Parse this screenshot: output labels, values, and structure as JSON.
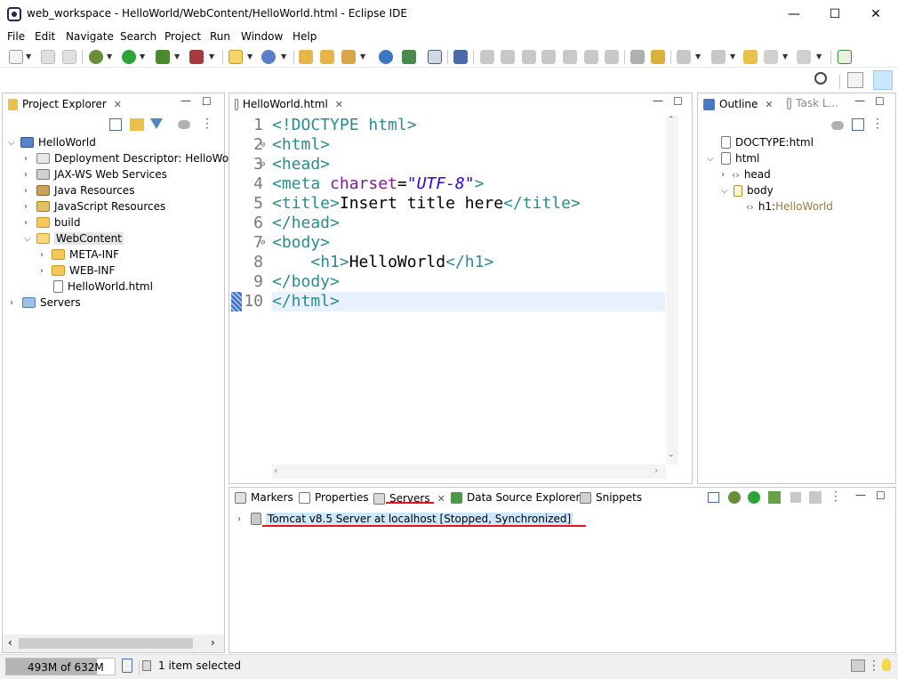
{
  "window": {
    "title": "web_workspace - HelloWorld/WebContent/HelloWorld.html - Eclipse IDE",
    "minimize": "—",
    "maximize": "☐",
    "close": "✕"
  },
  "menu": [
    "File",
    "Edit",
    "Navigate",
    "Search",
    "Project",
    "Run",
    "Window",
    "Help"
  ],
  "project_explorer": {
    "tab": "Project Explorer",
    "tree": [
      {
        "label": "HelloWorld"
      },
      {
        "label": "Deployment Descriptor: HelloWorld"
      },
      {
        "label": "JAX-WS Web Services"
      },
      {
        "label": "Java Resources"
      },
      {
        "label": "JavaScript Resources"
      },
      {
        "label": "build"
      },
      {
        "label": "WebContent"
      },
      {
        "label": "META-INF"
      },
      {
        "label": "WEB-INF"
      },
      {
        "label": "HelloWorld.html"
      },
      {
        "label": "Servers"
      }
    ]
  },
  "editor": {
    "tab": "HelloWorld.html",
    "lines": [
      {
        "n": "1"
      },
      {
        "n": "2"
      },
      {
        "n": "3"
      },
      {
        "n": "4"
      },
      {
        "n": "5"
      },
      {
        "n": "6"
      },
      {
        "n": "7"
      },
      {
        "n": "8"
      },
      {
        "n": "9"
      },
      {
        "n": "10"
      }
    ],
    "code": {
      "l1": "<!DOCTYPE html>",
      "l2": "<html>",
      "l3": "<head>",
      "l4_open": "<meta ",
      "l4_attr": "charset",
      "l4_eq": "=",
      "l4_str": "\"UTF-8\"",
      "l4_close": ">",
      "l5_open": "<title>",
      "l5_text": "Insert title here",
      "l5_close": "</title>",
      "l6": "</head>",
      "l7": "<body>",
      "l8_indent": "    ",
      "l8_open": "<h1>",
      "l8_text": "HelloWorld",
      "l8_close": "</h1>",
      "l9": "</body>",
      "l10": "</html>"
    }
  },
  "outline": {
    "tab": "Outline",
    "tab2": "Task L...",
    "tree": {
      "doctype": "DOCTYPE:html",
      "html": "html",
      "head": "head",
      "body": "body",
      "h1_tag": "h1",
      "h1_sep": " : ",
      "h1_value": "HelloWorld"
    }
  },
  "bottom_panel": {
    "tabs": [
      "Markers",
      "Properties",
      "Servers",
      "Data Source Explorer",
      "Snippets"
    ],
    "server_row": "Tomcat v8.5 Server at localhost  [Stopped, Synchronized]"
  },
  "status": {
    "heap": "493M of 632M",
    "selection": "1 item selected"
  },
  "colors": {
    "accent_red": "#e8141b",
    "selection_bg": "#cce8ff",
    "current_line": "#e8f2fe",
    "heap_bar": "#b4b4b4"
  }
}
